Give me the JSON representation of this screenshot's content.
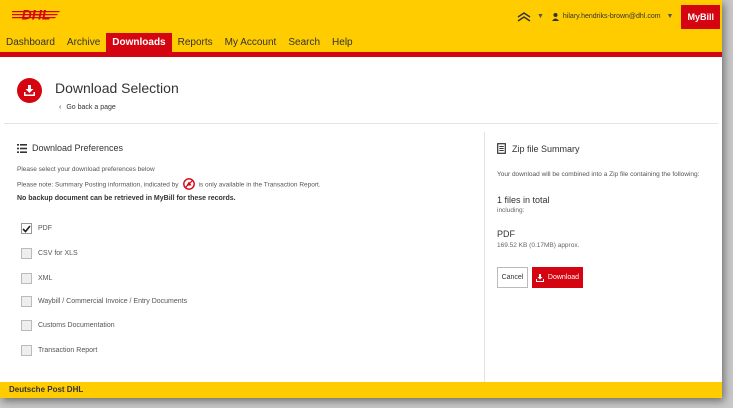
{
  "header": {
    "logo_text": "DHL",
    "user_email": "hilary.hendriks-brown@dhl.com",
    "app_button": "MyBill"
  },
  "nav": {
    "items": [
      "Dashboard",
      "Archive",
      "Downloads",
      "Reports",
      "My Account",
      "Search",
      "Help"
    ],
    "active": "Downloads"
  },
  "page": {
    "title": "Download Selection",
    "back_link": "Go back a page"
  },
  "preferences": {
    "title": "Download Preferences",
    "instruction": "Please select your download preferences below",
    "note_prefix": "Please note: Summary Posting information, indicated by",
    "note_suffix": "is only available in the Transaction Report.",
    "warning": "No backup document can be retrieved in MyBill for these records.",
    "options": [
      {
        "label": "PDF",
        "checked": true
      },
      {
        "label": "CSV for XLS",
        "checked": false
      },
      {
        "label": "XML",
        "checked": false
      },
      {
        "label": "Waybill / Commercial Invoice / Entry Documents",
        "checked": false
      },
      {
        "label": "Customs Documentation",
        "checked": false
      },
      {
        "label": "Transaction Report",
        "checked": false
      }
    ]
  },
  "zip_summary": {
    "title": "Zip file Summary",
    "description": "Your download will be combined into a Zip file containing the following:",
    "files_total": "1 files in total",
    "including": "including:",
    "file_type": "PDF",
    "file_size": "169.52 KB (0.17MB) approx.",
    "cancel_label": "Cancel",
    "download_label": "Download"
  },
  "footer": {
    "text": "Deutsche Post DHL"
  },
  "colors": {
    "brand_yellow": "#ffcc00",
    "brand_red": "#d40511"
  }
}
